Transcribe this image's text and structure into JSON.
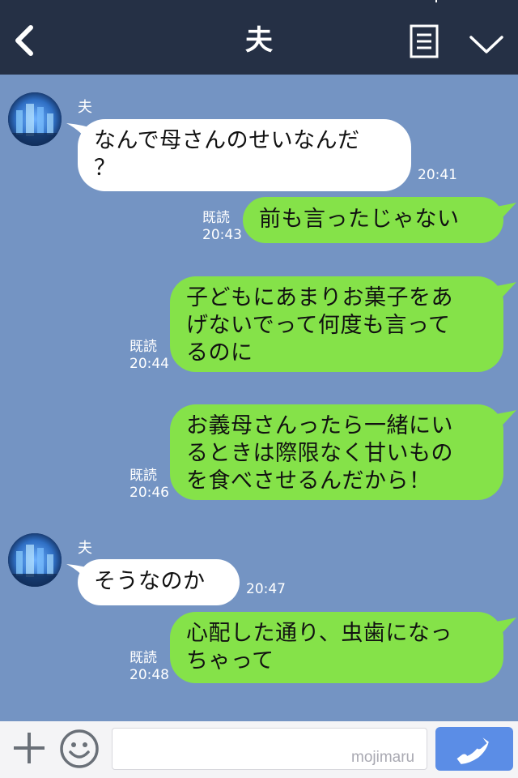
{
  "header": {
    "title": "夫"
  },
  "messages": [
    {
      "type": "in",
      "sender": "夫",
      "text": "なんで母さんのせいなんだ\n？",
      "time": "20:41"
    },
    {
      "type": "out",
      "read": "既読",
      "time": "20:43",
      "text": "前も言ったじゃない"
    },
    {
      "type": "out",
      "read": "既読",
      "time": "20:44",
      "text": "子どもにあまりお菓子をあ\nげないでって何度も言って\nるのに"
    },
    {
      "type": "out",
      "read": "既読",
      "time": "20:46",
      "text": "お義母さんったら一緒にい\nるときは際限なく甘いもの\nを食べさせるんだから！"
    },
    {
      "type": "in",
      "sender": "夫",
      "text": "そうなのか",
      "time": "20:47"
    },
    {
      "type": "out",
      "read": "既読",
      "time": "20:48",
      "text": "心配した通り、虫歯になっ\nちゃって"
    }
  ],
  "input": {
    "placeholder": "",
    "watermark": "mojimaru"
  },
  "colors": {
    "header_bg": "#253045",
    "chat_bg": "#7494c3",
    "out_bubble": "#85e249",
    "in_bubble": "#ffffff",
    "call_button": "#5b8de6"
  },
  "icons": [
    "back-arrow-icon",
    "menu-list-icon",
    "chevron-down-icon",
    "plus-icon",
    "smiley-icon",
    "phone-icon"
  ]
}
